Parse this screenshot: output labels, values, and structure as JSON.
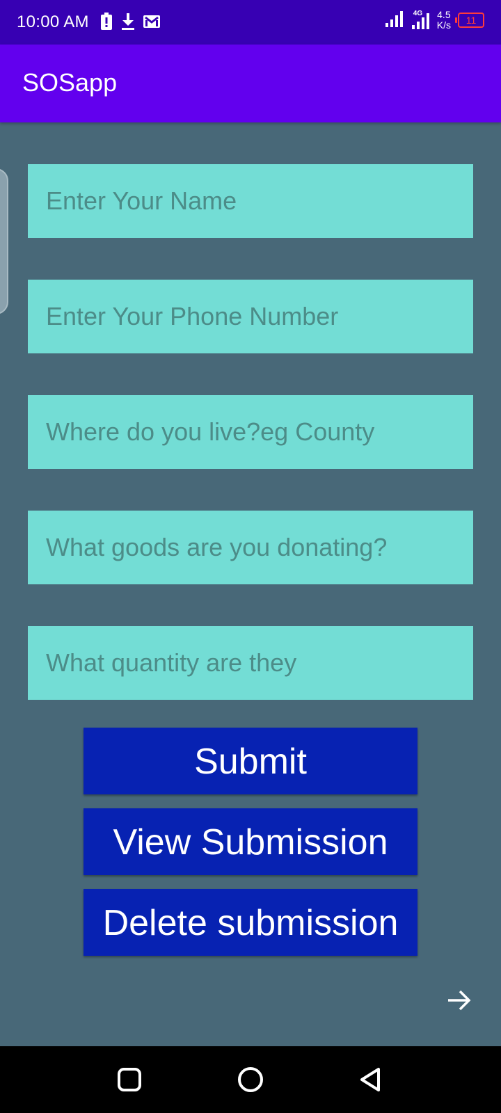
{
  "status_bar": {
    "time": "10:00 AM",
    "network_type": "4G",
    "speed_value": "4.5",
    "speed_unit": "K/s",
    "battery_level": "11",
    "icons": [
      "alert-icon",
      "download-icon",
      "gmail-icon",
      "signal-icon",
      "signal-4g-icon",
      "battery-icon"
    ]
  },
  "app_bar": {
    "title": "SOSapp"
  },
  "form": {
    "name_placeholder": "Enter Your Name",
    "phone_placeholder": "Enter Your Phone Number",
    "location_placeholder": "Where do you live?eg County",
    "goods_placeholder": "What goods are you donating?",
    "quantity_placeholder": "What quantity are they"
  },
  "buttons": {
    "submit": "Submit",
    "view": "View Submission",
    "delete": "Delete submission"
  },
  "colors": {
    "status_bar": "#3700b3",
    "app_bar": "#6200ee",
    "background": "#486878",
    "field": "#73ddd5",
    "button": "#0722b2"
  }
}
